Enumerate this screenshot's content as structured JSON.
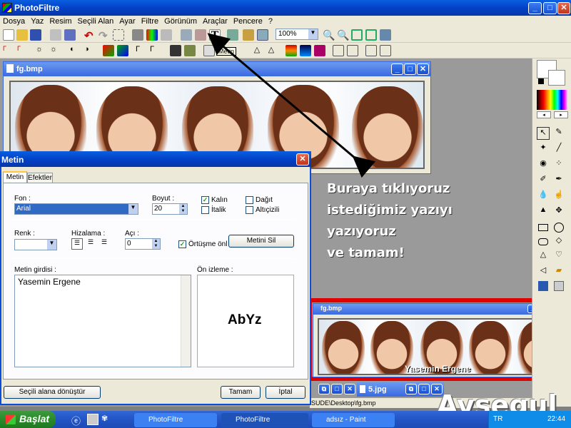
{
  "app": {
    "title": "PhotoFiltre",
    "zoom": "100%"
  },
  "menu": [
    "Dosya",
    "Yaz",
    "Resim",
    "Seçili Alan",
    "Ayar",
    "Filtre",
    "Görünüm",
    "Araçlar",
    "Pencere",
    "?"
  ],
  "toolbar": {
    "tooltip": "Metin"
  },
  "image_window": {
    "title": "fg.bmp"
  },
  "dialog": {
    "title": "Metin",
    "tabs": [
      "Metin",
      "Efektler"
    ],
    "font_label": "Fon :",
    "font_value": "Arial",
    "size_label": "Boyut :",
    "size_value": "20",
    "bold_label": "Kalın",
    "italic_label": "İtalik",
    "spread_label": "Dağıt",
    "underline_label": "Altıçizili",
    "color_label": "Renk :",
    "align_label": "Hizalama :",
    "angle_label": "Açı :",
    "angle_value": "0",
    "overlap_label": "Örtüşme önl",
    "delete_text_label": "Metini Sil",
    "text_input_label": "Metin girdisi :",
    "text_input_value": "Yasemin Ergene",
    "preview_label": "Ön izleme :",
    "preview_text": "AbYz",
    "convert_button": "Seçili alana  dönüştür",
    "ok_button": "Tamam",
    "cancel_button": "İptal"
  },
  "annotation": {
    "lines": [
      "Buraya tıklıyoruz",
      "istediğimiz yazıyı",
      "yazıyoruz",
      "ve tamam!"
    ]
  },
  "result_window": {
    "title": "fg.bmp",
    "caption": "Yasemin Ergene"
  },
  "jpg_window": {
    "title": "5.jpg"
  },
  "statusbar": {
    "path": "SUDE\\Desktop\\fg.bmp"
  },
  "watermark": "Aysegul",
  "taskbar": {
    "start_label": "Başlat",
    "tasks": [
      "PhotoFiltre",
      "PhotoFiltre",
      "adsız - Paint"
    ],
    "lang": "TR",
    "clock": "22:44"
  },
  "colors": {
    "highlight_box": "#e00000",
    "arrow": "#000000"
  }
}
